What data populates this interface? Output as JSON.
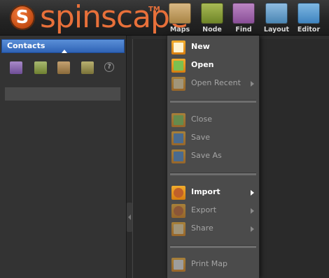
{
  "app": {
    "logo_text": "spinscape",
    "logo_tm": "TM",
    "logo_letter": "S"
  },
  "toolbar": {
    "tools": [
      {
        "label": "Maps",
        "icon": "maps-icon",
        "color": "#c9a46a"
      },
      {
        "label": "Node",
        "icon": "node-icon",
        "color": "#8fa43a"
      },
      {
        "label": "Find",
        "icon": "find-icon",
        "color": "#a46ab0"
      },
      {
        "label": "Layout",
        "icon": "layout-icon",
        "color": "#6a9fc8"
      },
      {
        "label": "Editor",
        "icon": "editor-icon",
        "color": "#5c9ed0"
      }
    ]
  },
  "panel": {
    "title": "Contacts",
    "help": "?",
    "tool_icons": [
      "contacts-tool-1-icon",
      "contacts-tool-2-icon",
      "contacts-tool-3-icon",
      "contacts-tool-4-icon"
    ]
  },
  "menu": {
    "items": [
      {
        "label": "New",
        "enabled": true,
        "submenu": false,
        "icon": "new-document-icon"
      },
      {
        "label": "Open",
        "enabled": true,
        "submenu": false,
        "icon": "open-icon"
      },
      {
        "label": "Open Recent",
        "enabled": false,
        "submenu": true,
        "icon": "open-recent-icon"
      },
      {
        "label": "Close",
        "enabled": false,
        "submenu": false,
        "icon": "close-icon"
      },
      {
        "label": "Save",
        "enabled": false,
        "submenu": false,
        "icon": "save-icon"
      },
      {
        "label": "Save As",
        "enabled": false,
        "submenu": false,
        "icon": "save-as-icon"
      },
      {
        "label": "Import",
        "enabled": true,
        "submenu": true,
        "icon": "import-icon"
      },
      {
        "label": "Export",
        "enabled": false,
        "submenu": true,
        "icon": "export-icon"
      },
      {
        "label": "Share",
        "enabled": false,
        "submenu": true,
        "icon": "share-icon"
      },
      {
        "label": "Print Map",
        "enabled": false,
        "submenu": false,
        "icon": "print-icon"
      }
    ]
  },
  "colors": {
    "accent_orange": "#e8703a",
    "panel_header_blue": "#2f63b5",
    "menu_bg": "#4b4b4b"
  }
}
